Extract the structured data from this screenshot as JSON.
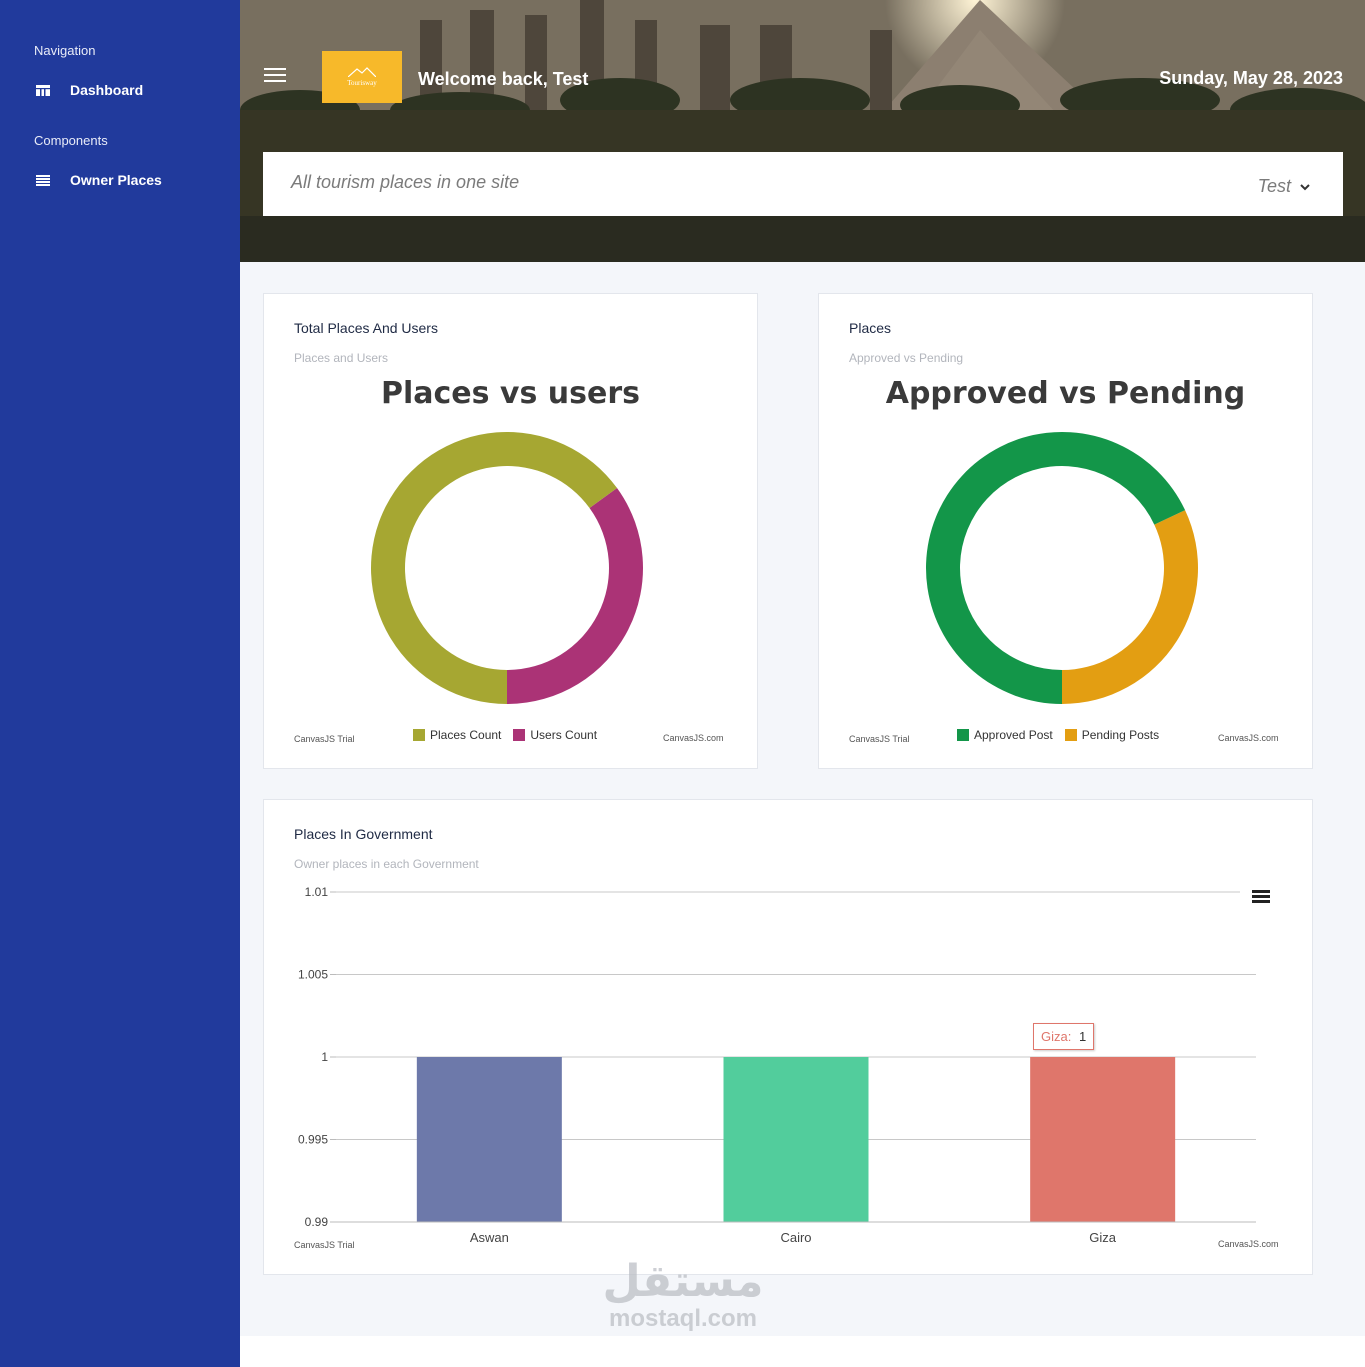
{
  "sidebar": {
    "nav_heading": "Navigation",
    "dashboard_label": "Dashboard",
    "components_heading": "Components",
    "owner_places_label": "Owner Places",
    "bg_color": "#213a9c"
  },
  "header": {
    "logo_text": "Tourisway",
    "welcome": "Welcome back, Test",
    "date": "Sunday, May 28, 2023",
    "tagline": "All tourism places in one site",
    "user_name": "Test",
    "logo_color": "#f7b92a"
  },
  "cards": {
    "places_users": {
      "title": "Total Places And Users",
      "subtitle": "Places and Users",
      "trial_left": "CanvasJS Trial",
      "trial_right": "CanvasJS.com"
    },
    "places_status": {
      "title": "Places",
      "subtitle": "Approved vs Pending",
      "trial_left": "CanvasJS Trial",
      "trial_right": "CanvasJS.com"
    },
    "government": {
      "title": "Places In Government",
      "subtitle": "Owner places in each Government",
      "trial_left": "CanvasJS Trial",
      "trial_right": "CanvasJS.com",
      "tooltip_label": "Giza:",
      "tooltip_value": "1"
    }
  },
  "chart_data": [
    {
      "type": "pie",
      "title": "Places vs users",
      "categories": [
        "Places Count",
        "Users Count"
      ],
      "values": [
        65,
        35
      ],
      "colors": [
        "#a6a732",
        "#ab3376"
      ],
      "legend": "bottom"
    },
    {
      "type": "pie",
      "title": "Approved vs Pending",
      "categories": [
        "Approved Post",
        "Pending Posts"
      ],
      "values": [
        68,
        32
      ],
      "colors": [
        "#139649",
        "#e39e12"
      ],
      "legend": "bottom"
    },
    {
      "type": "bar",
      "title": "",
      "categories": [
        "Aswan",
        "Cairo",
        "Giza"
      ],
      "values": [
        1,
        1,
        1
      ],
      "colors": [
        "#6d79aa",
        "#52cd9c",
        "#df766b"
      ],
      "ylim": [
        0.99,
        1.01
      ],
      "yticks": [
        "1.01",
        "1.005",
        "1",
        "0.995",
        "0.99"
      ],
      "grid": true
    }
  ],
  "watermark": {
    "arabic": "مستقل",
    "latin": "mostaql.com"
  }
}
